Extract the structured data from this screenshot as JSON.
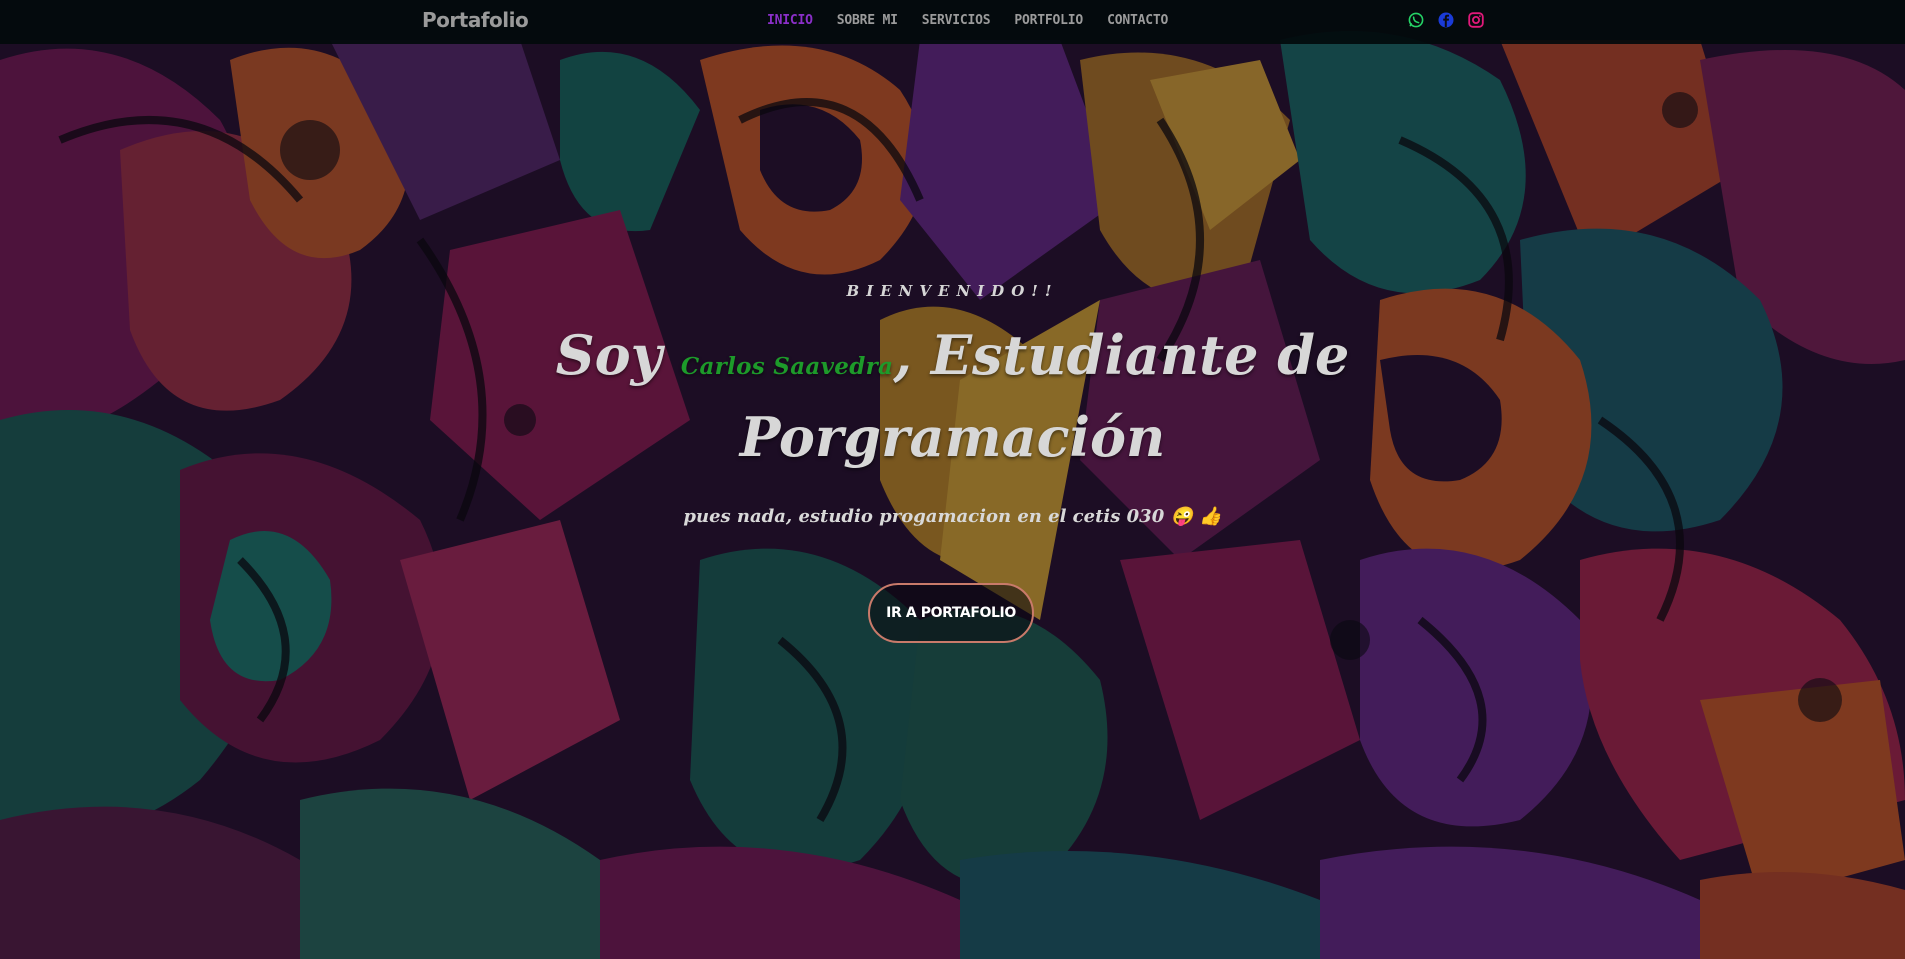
{
  "navbar": {
    "brand": "Portafolio",
    "menu": [
      {
        "label": "INICIO",
        "active": true
      },
      {
        "label": "SOBRE MI",
        "active": false
      },
      {
        "label": "SERVICIOS",
        "active": false
      },
      {
        "label": "PORTFOLIO",
        "active": false
      },
      {
        "label": "CONTACTO",
        "active": false
      }
    ],
    "socials": [
      {
        "icon": "whatsapp-icon",
        "color": "#25d366"
      },
      {
        "icon": "facebook-icon",
        "color": "#1a3bd8"
      },
      {
        "icon": "instagram-icon",
        "color": "#e1197a"
      }
    ]
  },
  "hero": {
    "welcome": "BIENVENIDO!!",
    "headline_prefix": "Soy ",
    "name": "Carlos Saavedra",
    "headline_suffix": ", Estudiante de Porgramación",
    "description": "pues nada, estudio progamacion en el cetis 030 😜 👍",
    "button_label": "IR A PORTAFOLIO"
  },
  "colors": {
    "accent_active": "#8b2fc9",
    "name_green": "#1d9a2a",
    "button_border": "#c97a6a"
  }
}
